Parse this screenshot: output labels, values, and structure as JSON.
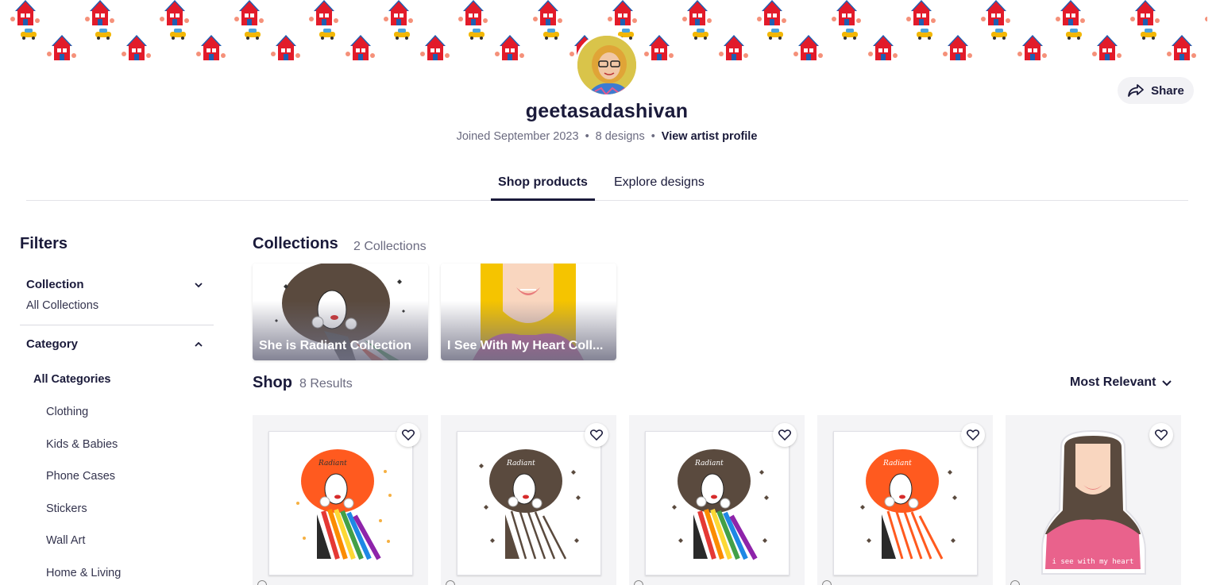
{
  "artist": {
    "name": "geetasadashivan",
    "joined": "Joined September 2023",
    "designs": "8 designs",
    "profile_link": "View artist profile"
  },
  "share_label": "Share",
  "tabs": {
    "shop": "Shop products",
    "explore": "Explore designs"
  },
  "filters": {
    "title": "Filters",
    "collection": {
      "label": "Collection",
      "value": "All Collections"
    },
    "category": {
      "label": "Category",
      "all": "All Categories",
      "items": [
        "Clothing",
        "Kids & Babies",
        "Phone Cases",
        "Stickers",
        "Wall Art",
        "Home & Living"
      ]
    }
  },
  "collections": {
    "title": "Collections",
    "count": "2 Collections",
    "items": [
      {
        "label": "She is Radiant Collection"
      },
      {
        "label": "I See With My Heart Coll..."
      }
    ]
  },
  "shop": {
    "title": "Shop",
    "count": "8 Results",
    "sort": "Most Relevant",
    "sticker_text": "i see with my heart"
  },
  "colors": {
    "accent": "#1a1a3a",
    "afro_orange": "#ff5a1f",
    "afro_brown": "#5a4a3e"
  }
}
